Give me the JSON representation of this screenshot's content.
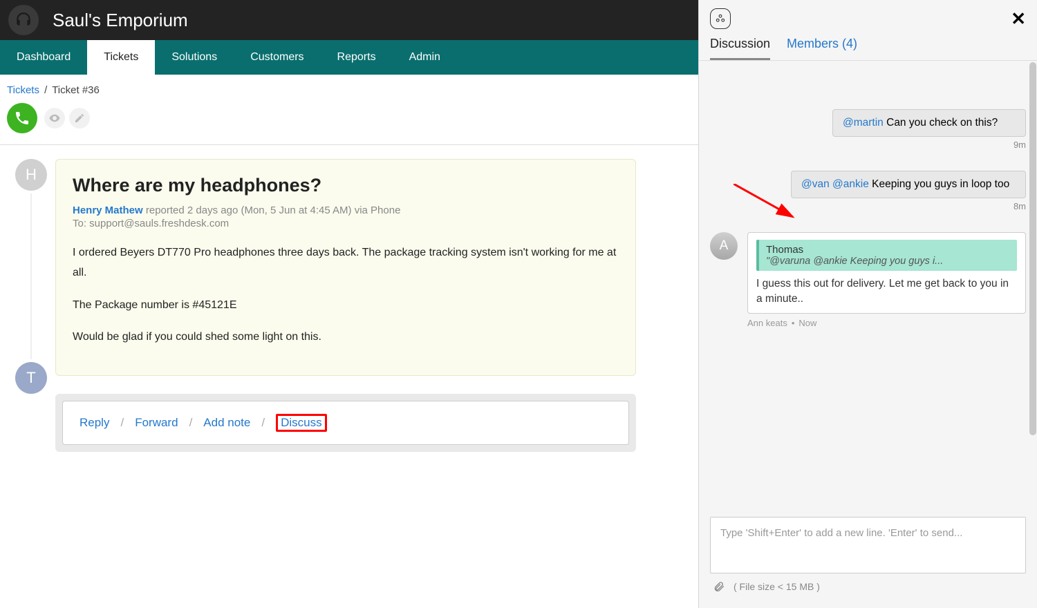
{
  "header": {
    "company": "Saul's Emporium"
  },
  "nav": {
    "items": [
      "Dashboard",
      "Tickets",
      "Solutions",
      "Customers",
      "Reports",
      "Admin"
    ],
    "active_index": 1
  },
  "breadcrumb": {
    "root": "Tickets",
    "current": "Ticket #36"
  },
  "toolbar": {
    "discuss": "Discuss",
    "reply": "Reply",
    "forward": "Forward",
    "add": "Ad"
  },
  "ticket": {
    "title": "Where are my headphones?",
    "author": "Henry Mathew",
    "reported": "reported 2 days ago (Mon, 5 Jun at 4:45 AM) via Phone",
    "to": "To: support@sauls.freshdesk.com",
    "body": [
      "I ordered Beyers DT770 Pro headphones three days back. The package tracking system isn't working for me at all.",
      "The Package number is #45121E",
      "Would be glad if you could shed some light on this."
    ],
    "avatar_initial": "H",
    "reply_avatar_initial": "T"
  },
  "reply_bar": {
    "reply": "Reply",
    "forward": "Forward",
    "add_note": "Add note",
    "discuss": "Discuss"
  },
  "discussion": {
    "tab_discussion": "Discussion",
    "tab_members": "Members (4)",
    "messages": [
      {
        "mention": "@martin",
        "text": " Can you check on this?",
        "time": "9m"
      },
      {
        "mentions": [
          "@van",
          "@ankie"
        ],
        "text": " Keeping you guys in loop too",
        "time": "8m"
      }
    ],
    "reply_msg": {
      "avatar": "A",
      "quote_author": "Thomas",
      "quote_text": "\"@varuna @ankie Keeping you guys i...",
      "body": "I guess this out for delivery. Let me get back to you in a minute..",
      "meta_author": "Ann keats",
      "meta_time": "Now"
    },
    "compose_placeholder": "Type 'Shift+Enter' to add a new line. 'Enter' to send...",
    "attach_hint": "( File size < 15 MB )"
  }
}
